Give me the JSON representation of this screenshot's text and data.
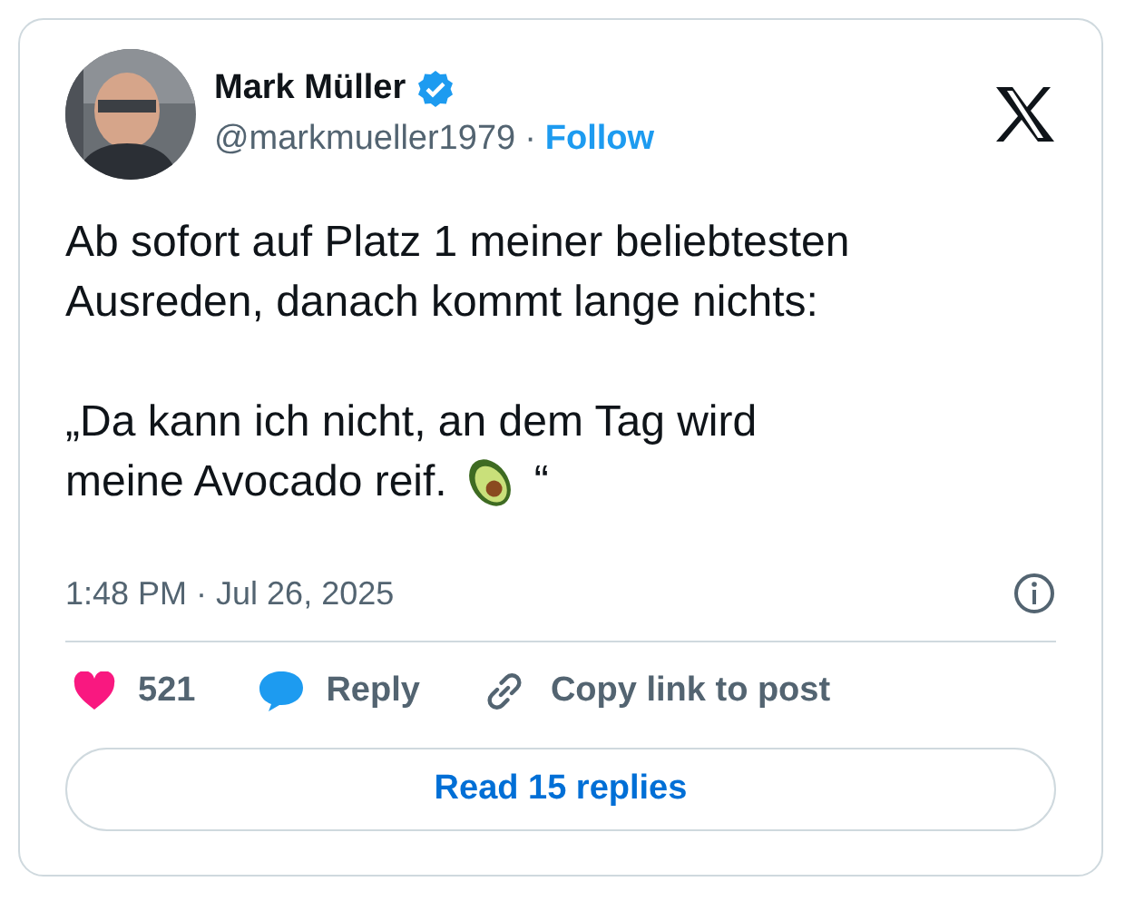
{
  "author": {
    "name": "Mark Müller",
    "verified": true,
    "handle": "@markmueller1979",
    "separator": "·",
    "follow": "Follow"
  },
  "text": {
    "lines": [
      "Ab sofort auf Platz 1 meiner beliebtesten Ausreden, danach kommt lange nichts:"
    ],
    "quote": [
      "„Da kann ich nicht, an dem Tag wird",
      "meine Avocado reif."
    ],
    "quote_end": "“"
  },
  "timestamp": "1:48 PM · Jul 26, 2025",
  "actions": [
    {
      "kind": "like",
      "label": "521"
    },
    {
      "kind": "reply",
      "label": "Reply"
    },
    {
      "kind": "copy",
      "label": "Copy link to post"
    }
  ],
  "read_button": "Read 15 replies"
}
